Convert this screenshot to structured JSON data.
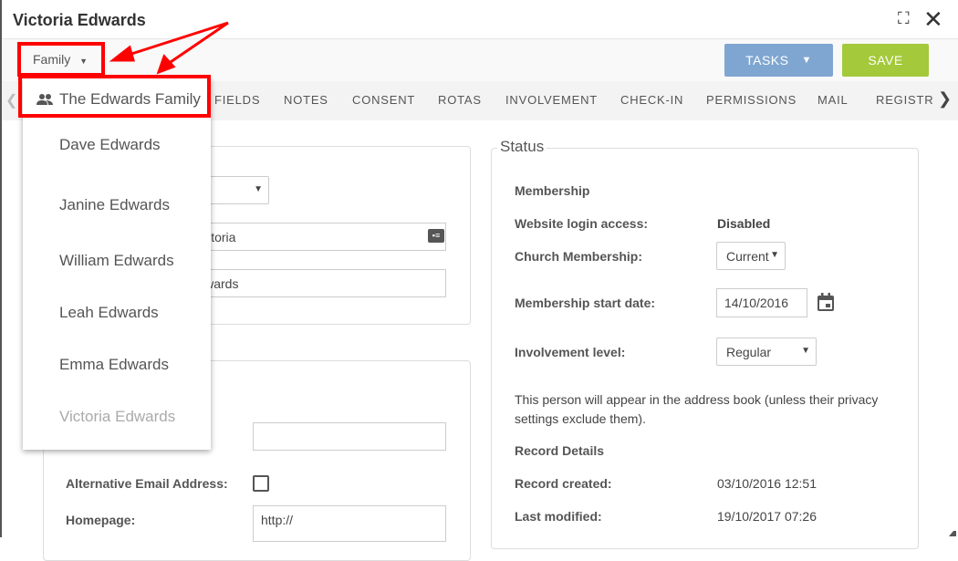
{
  "window": {
    "title": "Victoria Edwards",
    "expand_icon": "expand-icon",
    "close_icon": "close-icon"
  },
  "toolbar": {
    "family_label": "Family",
    "tasks_label": "TASKS",
    "save_label": "SAVE"
  },
  "tabs": [
    "FIELDS",
    "NOTES",
    "CONSENT",
    "ROTAS",
    "INVOLVEMENT",
    "CHECK-IN",
    "PERMISSIONS",
    "MAIL",
    "REGISTR."
  ],
  "family_menu": {
    "family_name": "The Edwards Family",
    "members": [
      {
        "name": "Dave Edwards",
        "icon": "man-icon",
        "color": "#7ba2cc"
      },
      {
        "name": "Janine Edwards",
        "icon": "woman-icon",
        "color": "#b85c86"
      },
      {
        "name": "William Edwards",
        "icon": "boy-icon",
        "color": "#7ba2cc"
      },
      {
        "name": "Leah Edwards",
        "icon": "girl-icon",
        "color": "#b85c86"
      },
      {
        "name": "Emma Edwards",
        "icon": "girl-icon",
        "color": "#b85c86"
      },
      {
        "name": "Victoria Edwards",
        "icon": "girl-icon",
        "color": "#b85c86",
        "current": true
      }
    ]
  },
  "left_form": {
    "first_name": "Victoria",
    "last_name": "Edwards",
    "alt_email_label": "Alternative Email Address:",
    "alt_email_checked": false,
    "homepage_label": "Homepage:",
    "homepage_value": "http://"
  },
  "status": {
    "legend": "Status",
    "membership_heading": "Membership",
    "website_login_label": "Website login access:",
    "website_login_value": "Disabled",
    "church_membership_label": "Church Membership:",
    "church_membership_value": "Current",
    "start_date_label": "Membership start date:",
    "start_date_value": "14/10/2016",
    "involvement_label": "Involvement level:",
    "involvement_value": "Regular",
    "address_book_note": "This person will appear in the address book (unless their privacy settings exclude them).",
    "record_heading": "Record Details",
    "created_label": "Record created:",
    "created_value": "03/10/2016 12:51",
    "modified_label": "Last modified:",
    "modified_value": "19/10/2017 07:26"
  },
  "annotation_color": "#ff0000"
}
